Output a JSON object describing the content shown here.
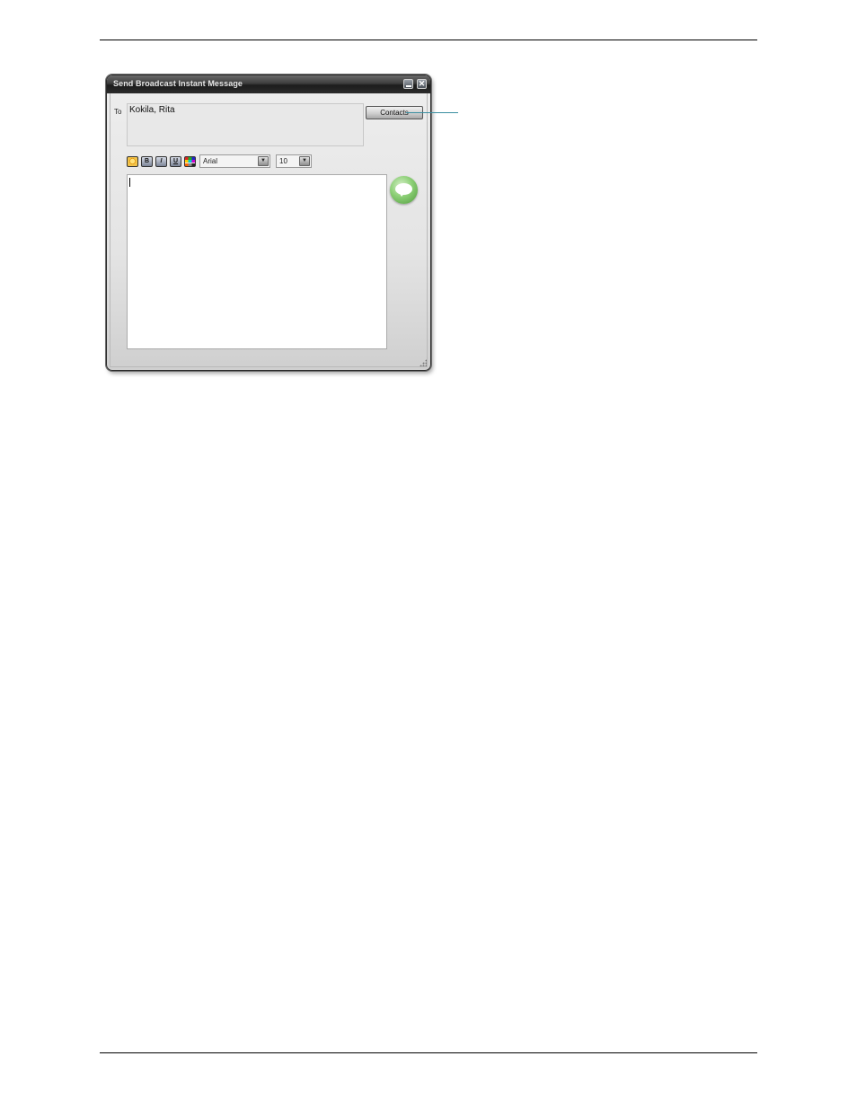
{
  "window": {
    "title": "Send Broadcast Instant Message",
    "minimize_symbol": "",
    "close_symbol": "✕"
  },
  "recipients": {
    "label": "To",
    "value": "Kokila, Rita",
    "contacts_button": "Contacts"
  },
  "formatting": {
    "emoticon_icon": "emoticon-icon",
    "bold_label": "B",
    "italic_label": "I",
    "underline_label": "U",
    "color_icon": "color-palette-icon",
    "font_value": "Arial",
    "size_value": "10",
    "dropdown_symbol": "▼"
  },
  "message": {
    "value": ""
  },
  "send": {
    "icon": "speech-bubble-icon"
  },
  "colors": {
    "callout_line": "#3a8ea0",
    "send_green": "#4f9a3c"
  }
}
